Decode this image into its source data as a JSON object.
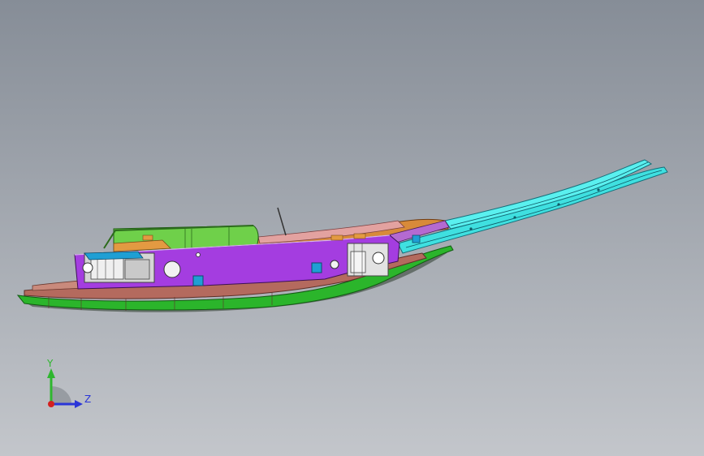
{
  "viewport": {
    "background_top": "#868d97",
    "background_bottom": "#c3c6cb"
  },
  "model": {
    "parts": [
      {
        "name": "base-plate",
        "color": "#2bb52b"
      },
      {
        "name": "base-layer",
        "color": "#b46a5e"
      },
      {
        "name": "side-frame",
        "color": "#a43de0"
      },
      {
        "name": "upper-cover",
        "color": "#6fd04a"
      },
      {
        "name": "guide-rail",
        "color": "#3fe0e0"
      },
      {
        "name": "top-plates",
        "color": "#d88a3a"
      },
      {
        "name": "brackets",
        "color": "#e6e6e6"
      },
      {
        "name": "clamp-blocks",
        "color": "#1f9fd4"
      }
    ]
  },
  "triad": {
    "y_label": "Y",
    "z_label": "Z",
    "y_color": "#2fb62f",
    "z_color": "#2a35d8",
    "x_color": "#d32020"
  }
}
